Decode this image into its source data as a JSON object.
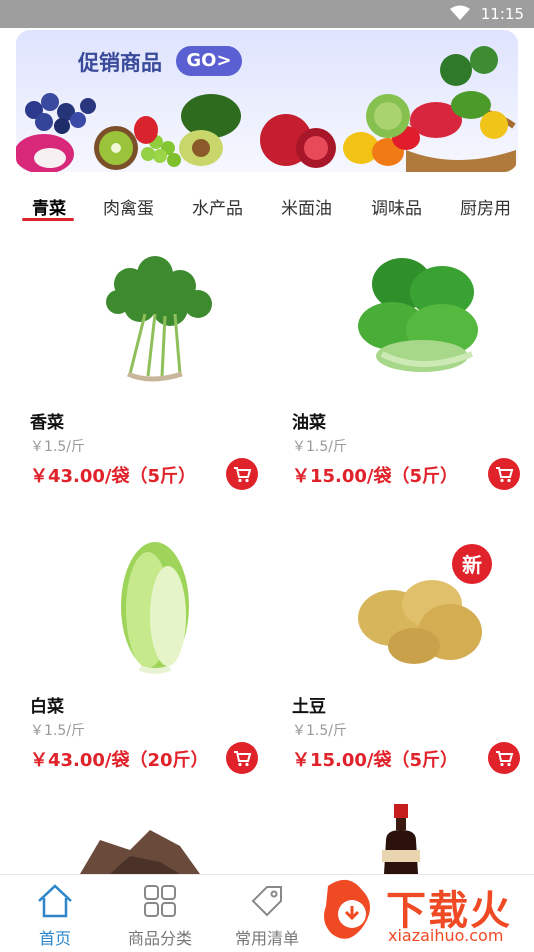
{
  "status_bar": {
    "time": "11:15",
    "wifi_icon": "wifi-icon"
  },
  "banner": {
    "promo_text": "促销商品",
    "go_label": "GO>"
  },
  "tabs": [
    {
      "label": "青菜",
      "active": true
    },
    {
      "label": "肉禽蛋"
    },
    {
      "label": "水产品"
    },
    {
      "label": "米面油"
    },
    {
      "label": "调味品"
    },
    {
      "label": "厨房用"
    }
  ],
  "products": [
    {
      "name": "香菜",
      "unit": "￥1.5/斤",
      "price": "￥43.00/袋（5斤）",
      "badge": ""
    },
    {
      "name": "油菜",
      "unit": "￥1.5/斤",
      "price": "￥15.00/袋（5斤）",
      "badge": ""
    },
    {
      "name": "白菜",
      "unit": "￥1.5/斤",
      "price": "￥43.00/袋（20斤）",
      "badge": ""
    },
    {
      "name": "土豆",
      "unit": "￥1.5/斤",
      "price": "￥15.00/袋（5斤）",
      "badge": "新"
    }
  ],
  "bottom_nav": [
    {
      "label": "首页",
      "icon": "home-icon",
      "active": true
    },
    {
      "label": "商品分类",
      "icon": "grid-icon"
    },
    {
      "label": "常用清单",
      "icon": "tag-icon"
    }
  ],
  "watermark": {
    "brand": "下载火",
    "url": "xiazaihuo.com"
  },
  "colors": {
    "accent_red": "#e0222a",
    "nav_active": "#2c86c9",
    "status_bar": "#9e9e9e"
  }
}
